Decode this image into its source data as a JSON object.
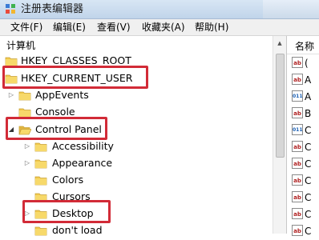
{
  "window": {
    "title": "注册表编辑器"
  },
  "menu": [
    {
      "label": "文件(F)"
    },
    {
      "label": "编辑(E)"
    },
    {
      "label": "查看(V)"
    },
    {
      "label": "收藏夹(A)"
    },
    {
      "label": "帮助(H)"
    }
  ],
  "tree": {
    "root": "计算机",
    "nodes": [
      {
        "label": "HKEY_CLASSES_ROOT",
        "expander": "none"
      },
      {
        "label": "HKEY_CURRENT_USER",
        "expander": "none",
        "highlighted": true
      },
      {
        "label": "AppEvents",
        "expander": "collapsed"
      },
      {
        "label": "Console",
        "expander": "none"
      },
      {
        "label": "Control Panel",
        "expander": "expanded",
        "highlighted": true
      },
      {
        "label": "Accessibility",
        "expander": "collapsed"
      },
      {
        "label": "Appearance",
        "expander": "collapsed"
      },
      {
        "label": "Colors",
        "expander": "none"
      },
      {
        "label": "Cursors",
        "expander": "none"
      },
      {
        "label": "Desktop",
        "expander": "collapsed",
        "highlighted": true
      },
      {
        "label": "don't load",
        "expander": "none"
      }
    ]
  },
  "right_pane": {
    "header": "名称",
    "rows": [
      {
        "icon": "string-value-icon",
        "text": "("
      },
      {
        "icon": "string-value-icon",
        "text": "A"
      },
      {
        "icon": "binary-value-icon",
        "text": "A"
      },
      {
        "icon": "string-value-icon",
        "text": "B"
      },
      {
        "icon": "binary-value-icon",
        "text": "C"
      },
      {
        "icon": "string-value-icon",
        "text": "C"
      },
      {
        "icon": "string-value-icon",
        "text": "C"
      },
      {
        "icon": "string-value-icon",
        "text": "C"
      },
      {
        "icon": "string-value-icon",
        "text": "C"
      },
      {
        "icon": "string-value-icon",
        "text": "C"
      },
      {
        "icon": "string-value-icon",
        "text": "C"
      }
    ]
  },
  "colors": {
    "highlight": "#d22b37",
    "folder": "#f2c94c"
  }
}
